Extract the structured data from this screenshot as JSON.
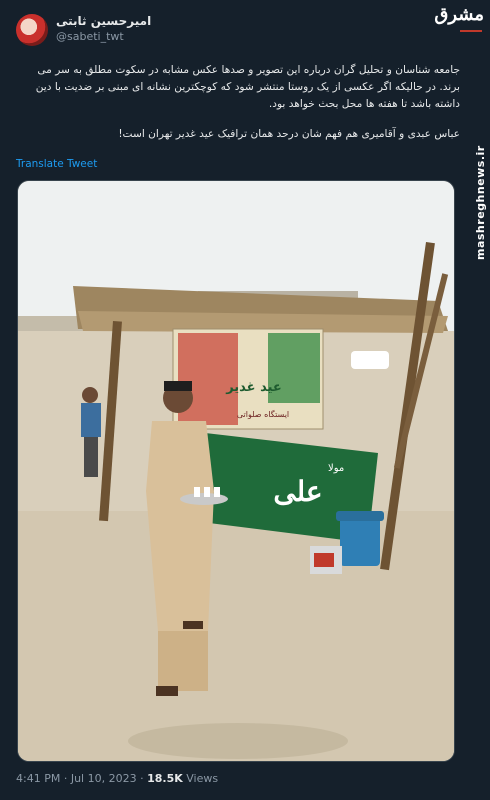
{
  "tweet": {
    "display_name": "امیرحسین ثابتی",
    "handle": "@sabeti_twt",
    "paragraph1": "جامعه شناسان و تحلیل گران درباره این تصویر و صدها عکس مشابه در سکوت مطلق به سر می برند. در حالیکه اگر عکسی از یک روستا منتشر شود که کوچکترین نشانه ای مبنی بر ضدیت با دین داشته باشد تا هفته ها محل بحث خواهد بود.",
    "paragraph2": "عباس عبدی و آقامیری هم فهم شان درحد همان ترافیک عید غدیر تهران است!",
    "translate_label": "Translate Tweet",
    "time": "4:41 PM",
    "separator": "·",
    "date": "Jul 10, 2023",
    "views_count": "18.5K",
    "views_label": "Views"
  },
  "watermark": {
    "logo": "مشرق",
    "site": "mashreghnews.ir"
  },
  "photo": {
    "banner_top_text": "عید غدیر",
    "banner_top_sub": "ایستگاه صلواتی",
    "green_banner_small": "مولا",
    "green_banner_big": "علی",
    "sky_color": "#f2f4f3",
    "sand_color": "#d8cdb8",
    "green_banner_color": "#1f6b3a"
  }
}
